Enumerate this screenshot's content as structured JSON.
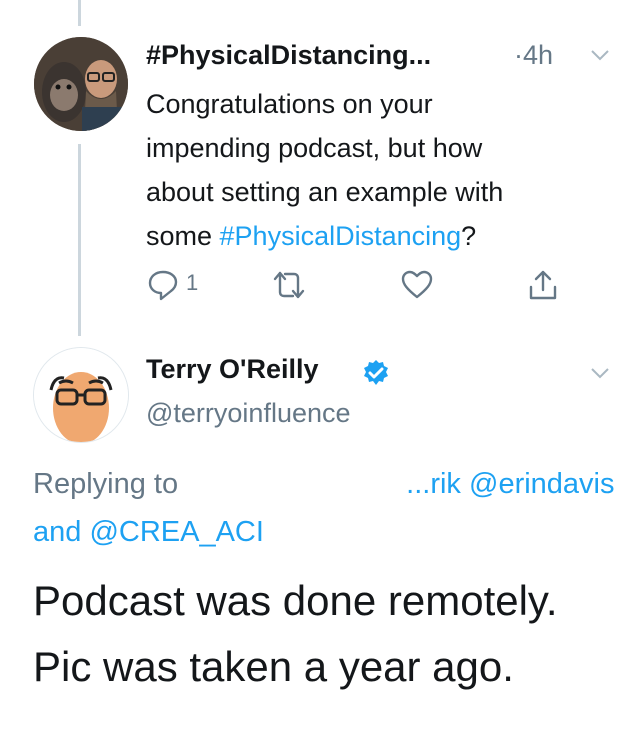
{
  "tweet1": {
    "display_name": "#PhysicalDistancing...",
    "time": "·4h",
    "body_lines": [
      "Congratulations on your",
      "impending podcast, but how",
      "about setting an example with"
    ],
    "body_last_prefix": "some ",
    "body_hashtag": "#PhysicalDistancing",
    "body_suffix": "?",
    "reply_count": "1"
  },
  "tweet2": {
    "display_name": "Terry O'Reilly",
    "handle": "@terryoinfluence",
    "replying_prefix": "Replying to ",
    "replying_partial": "...rik",
    "replying_mention1": "@erindavis",
    "replying_and": "and",
    "replying_mention2": "@CREA_ACI",
    "body_lines": [
      "Podcast was done remotely.",
      "Pic was taken a year ago."
    ]
  },
  "icons": {
    "reply": "reply-icon",
    "retweet": "retweet-icon",
    "like": "heart-icon",
    "share": "share-icon",
    "more": "chevron-down-icon",
    "verified": "verified-badge-icon"
  },
  "colors": {
    "link": "#1da1f2",
    "secondary": "#657786",
    "text": "#14171a",
    "thread_line": "#ccd6dd",
    "verified": "#1da1f2"
  }
}
